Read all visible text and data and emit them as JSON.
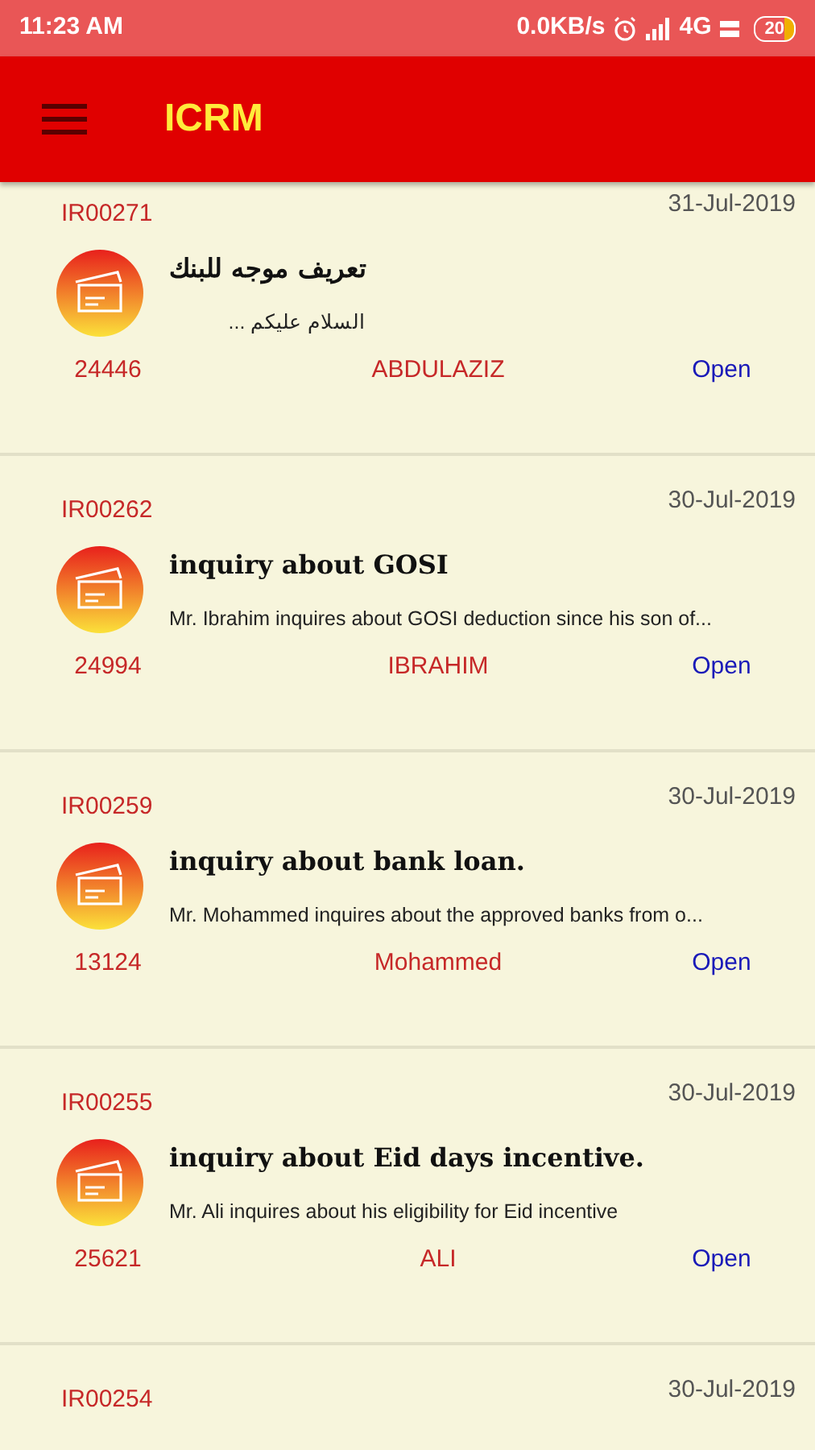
{
  "status_bar": {
    "time": "11:23 AM",
    "speed": "0.0KB/s",
    "network": "4G",
    "battery": "20"
  },
  "app_bar": {
    "title": "ICRM"
  },
  "tickets": [
    {
      "id": "IR00271",
      "date": "31-Jul-2019",
      "title": "تعريف موجه للبنك",
      "description": "السلام عليكم ...",
      "number": "24446",
      "name": "ABDULAZIZ",
      "status": "Open"
    },
    {
      "id": "IR00262",
      "date": "30-Jul-2019",
      "title": "inquiry about GOSI",
      "description": "Mr. Ibrahim inquires about GOSI deduction since his son of...",
      "number": "24994",
      "name": "IBRAHIM",
      "status": "Open"
    },
    {
      "id": "IR00259",
      "date": "30-Jul-2019",
      "title": "inquiry about bank loan.",
      "description": "Mr. Mohammed inquires about the approved banks from o...",
      "number": "13124",
      "name": "Mohammed",
      "status": "Open"
    },
    {
      "id": "IR00255",
      "date": "30-Jul-2019",
      "title": "inquiry about Eid days incentive.",
      "description": "Mr. Ali inquires about his eligibility for Eid incentive",
      "number": "25621",
      "name": "ALI",
      "status": "Open"
    },
    {
      "id": "IR00254",
      "date": "30-Jul-2019"
    }
  ]
}
